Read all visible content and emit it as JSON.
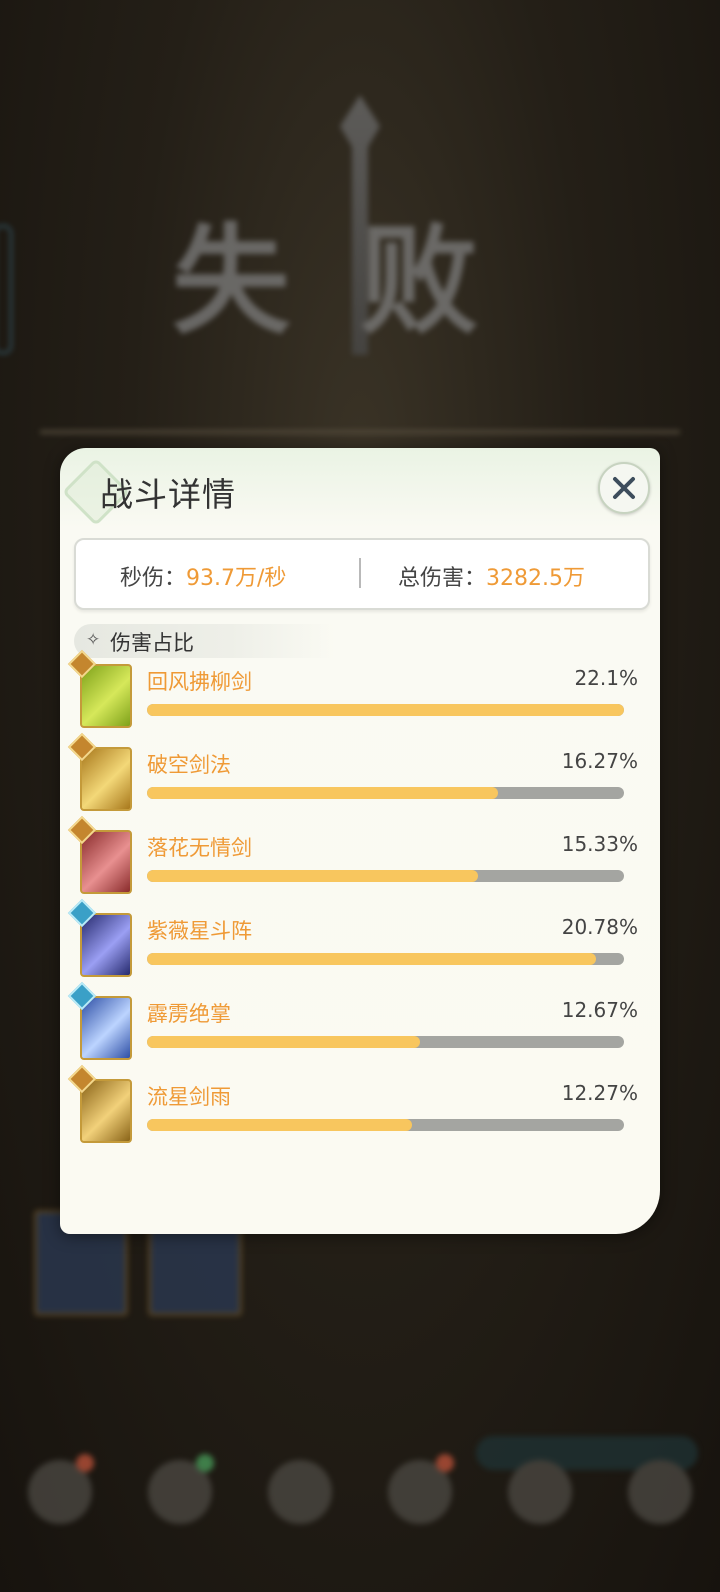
{
  "background": {
    "result_text": "失败"
  },
  "dialog": {
    "title": "战斗详情",
    "close_icon": "close-icon",
    "stats": {
      "dps_label": "秒伤：",
      "dps_value": "93.7万/秒",
      "total_label": "总伤害：",
      "total_value": "3282.5万"
    },
    "section_title": "伤害占比",
    "skills": [
      {
        "name": "回风拂柳剑",
        "percent": "22.1%",
        "share": 22.1,
        "icon": "sword-swirl-icon",
        "colors": [
          "#7fa21a",
          "#d6e85a"
        ]
      },
      {
        "name": "破空剑法",
        "percent": "16.27%",
        "share": 16.27,
        "icon": "sword-strike-icon",
        "colors": [
          "#a8781c",
          "#f3d878"
        ]
      },
      {
        "name": "落花无情剑",
        "percent": "15.33%",
        "share": 15.33,
        "icon": "falling-swords-icon",
        "colors": [
          "#8a2c2c",
          "#e89090"
        ]
      },
      {
        "name": "紫薇星斗阵",
        "percent": "20.78%",
        "share": 20.78,
        "icon": "star-formation-icon",
        "colors": [
          "#262a6e",
          "#9b9ff3"
        ]
      },
      {
        "name": "霹雳绝掌",
        "percent": "12.67%",
        "share": 12.67,
        "icon": "thunder-palm-icon",
        "colors": [
          "#2e4fa6",
          "#bcd4ff"
        ]
      },
      {
        "name": "流星剑雨",
        "percent": "12.27%",
        "share": 12.27,
        "icon": "meteor-swords-icon",
        "colors": [
          "#8a6418",
          "#f2d17a"
        ]
      }
    ],
    "max_share": 22.1
  }
}
